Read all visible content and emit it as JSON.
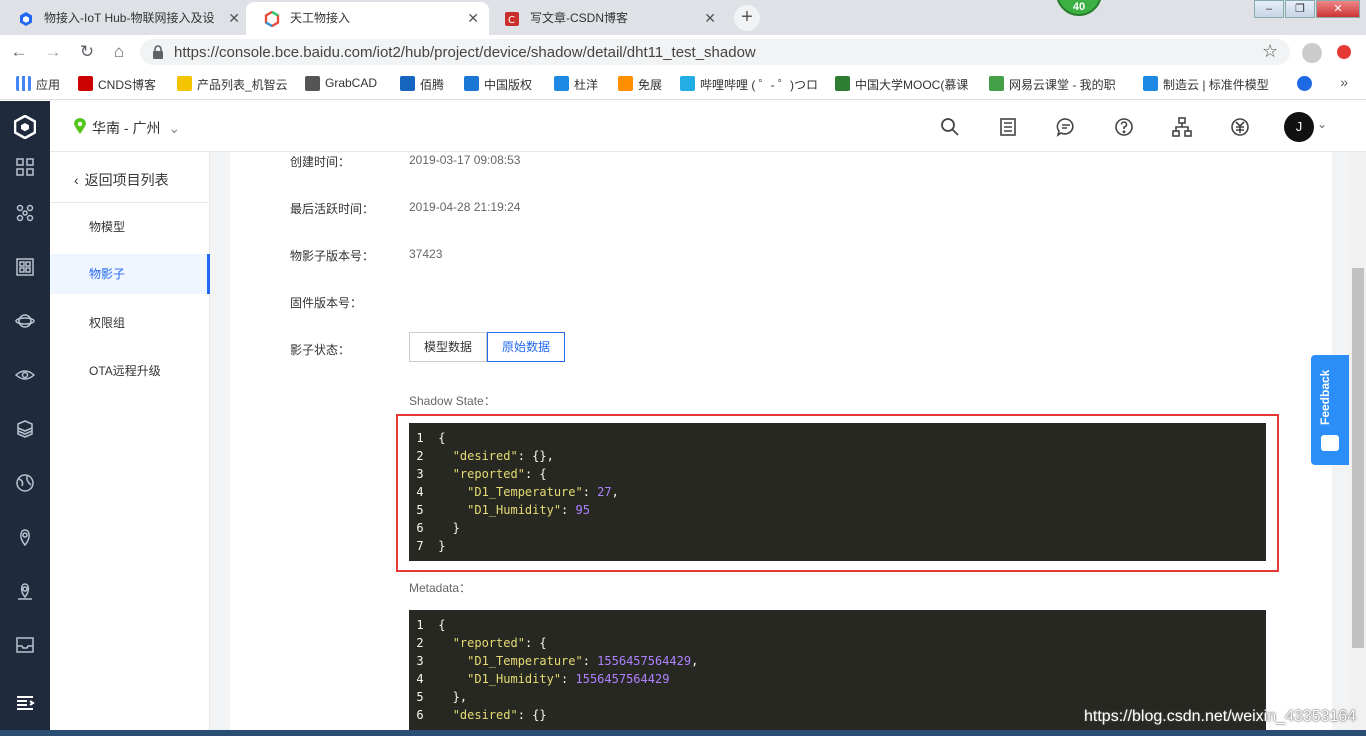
{
  "browser": {
    "tabs": [
      {
        "title": "物接入-IoT Hub-物联网接入及设",
        "close": "✕"
      },
      {
        "title": "天工物接入",
        "close": "✕"
      },
      {
        "title": "写文章-CSDN博客",
        "close": "✕"
      }
    ],
    "new_tab": "+",
    "badge": "40",
    "url": "https://console.bce.baidu.com/iot2/hub/project/device/shadow/detail/dht11_test_shadow",
    "bookmarks": [
      {
        "label": "应用",
        "color": "#e44"
      },
      {
        "label": "CNDS博客",
        "color": "#c00"
      },
      {
        "label": "产品列表_机智云",
        "color": "#f5c400"
      },
      {
        "label": "GrabCAD",
        "color": "#555"
      },
      {
        "label": "佰腾",
        "color": "#1565c0"
      },
      {
        "label": "中国版权",
        "color": "#1976d2"
      },
      {
        "label": "杜洋",
        "color": "#1e88e5"
      },
      {
        "label": "免展",
        "color": "#ff8f00"
      },
      {
        "label": "哔哩哔哩 ( ゜- ゜)つロ",
        "color": "#23ade5"
      },
      {
        "label": "中国大学MOOC(慕课",
        "color": "#2e7d32"
      },
      {
        "label": "网易云课堂 - 我的职",
        "color": "#43a047"
      },
      {
        "label": "制造云 | 标准件模型",
        "color": "#1e88e5"
      },
      {
        "label": "",
        "color": "#1e6ae5"
      }
    ],
    "bookmarks_more": "»"
  },
  "header": {
    "region": "华南 - 广州",
    "region_caret": "⌄",
    "avatar_letter": "J",
    "avatar_caret": "⌄"
  },
  "subnav": {
    "back": "返回项目列表",
    "items": [
      "物模型",
      "物影子",
      "权限组",
      "OTA远程升级"
    ]
  },
  "details": {
    "created_label": "创建时间：",
    "created_value": "2019-03-17 09:08:53",
    "active_label": "最后活跃时间：",
    "active_value": "2019-04-28 21:19:24",
    "version_label": "物影子版本号：",
    "version_value": "37423",
    "firmware_label": "固件版本号：",
    "state_label": "影子状态：",
    "tab_model": "模型数据",
    "tab_raw": "原始数据",
    "shadow_state_title": "Shadow State：",
    "metadata_title": "Metadata："
  },
  "shadow_state_lines": [
    {
      "n": "1",
      "text": " {"
    },
    {
      "n": "2",
      "key": "\"desired\"",
      "rest": ": {},",
      "indent": "   "
    },
    {
      "n": "3",
      "key": "\"reported\"",
      "rest": ": {",
      "indent": "   "
    },
    {
      "n": "4",
      "key": "\"D1_Temperature\"",
      "rest": ": ",
      "num": "27",
      "tail": ",",
      "indent": "     "
    },
    {
      "n": "5",
      "key": "\"D1_Humidity\"",
      "rest": ": ",
      "num": "95",
      "tail": "",
      "indent": "     "
    },
    {
      "n": "6",
      "text": "   }"
    },
    {
      "n": "7",
      "text": " }"
    }
  ],
  "metadata_lines": [
    {
      "n": "1",
      "text": " {"
    },
    {
      "n": "2",
      "key": "\"reported\"",
      "rest": ": {",
      "indent": "   "
    },
    {
      "n": "3",
      "key": "\"D1_Temperature\"",
      "rest": ": ",
      "num": "1556457564429",
      "tail": ",",
      "indent": "     "
    },
    {
      "n": "4",
      "key": "\"D1_Humidity\"",
      "rest": ": ",
      "num": "1556457564429",
      "tail": "",
      "indent": "     "
    },
    {
      "n": "5",
      "text": "   },"
    },
    {
      "n": "6",
      "key": "\"desired\"",
      "rest": ": {}",
      "indent": "   "
    }
  ],
  "feedback": "Feedback",
  "watermark": "https://blog.csdn.net/weixin_43353164",
  "colors": {
    "primary": "#2468f2",
    "rail": "#1f2b3d",
    "code_bg": "#272822",
    "code_key": "#e6db74",
    "code_num": "#ae81ff",
    "highlight": "#e53935"
  }
}
